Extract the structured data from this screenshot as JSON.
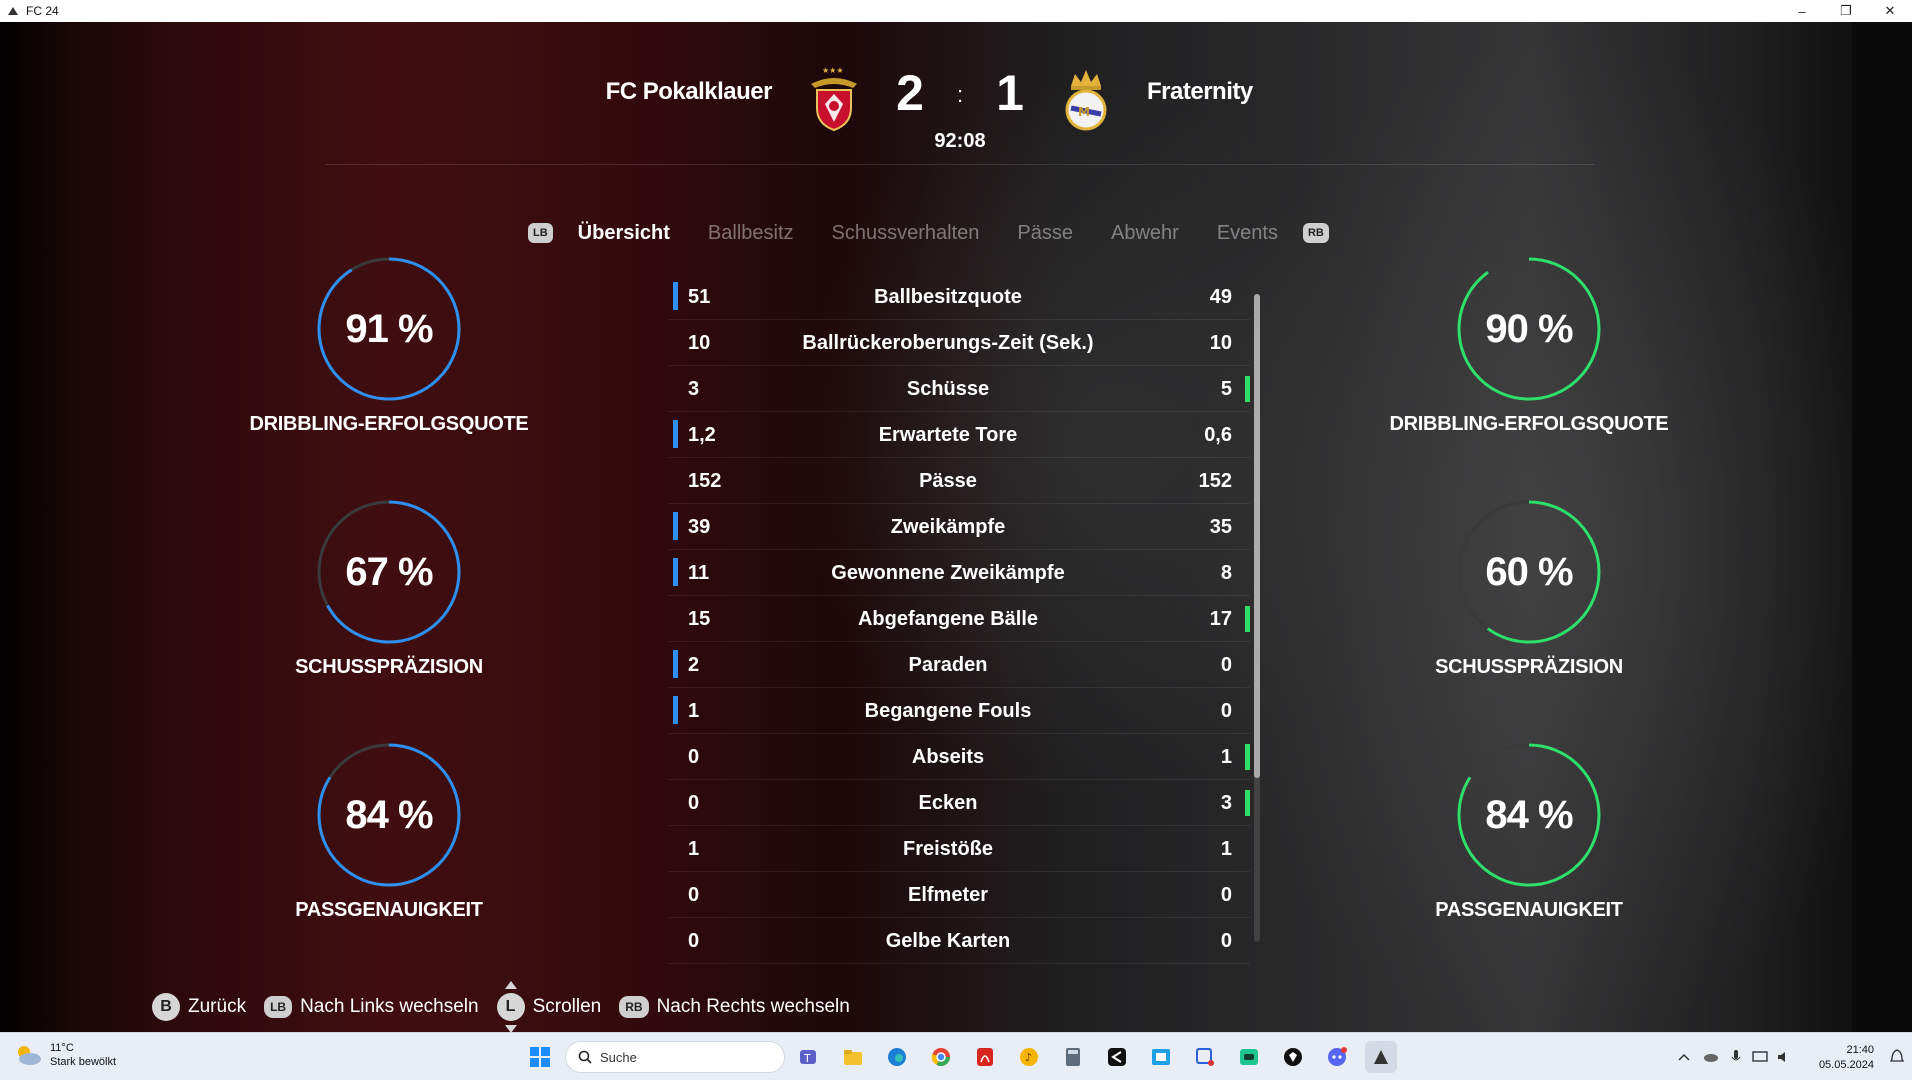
{
  "window": {
    "title": "FC 24",
    "controls": [
      "–",
      "❐",
      "✕"
    ]
  },
  "match": {
    "home_team": "FC Pokalklauer",
    "away_team": "Fraternity",
    "home_score": "2",
    "away_score": "1",
    "separator": ":",
    "time": "92:08"
  },
  "tabs": {
    "lb_badge": "LB",
    "rb_badge": "RB",
    "items": [
      "Übersicht",
      "Ballbesitz",
      "Schussverhalten",
      "Pässe",
      "Abwehr",
      "Events"
    ],
    "active_index": 0
  },
  "home_rings": [
    {
      "value": "91 %",
      "fraction": 0.91,
      "label": "DRIBBLING-ERFOLGSQUOTE"
    },
    {
      "value": "67 %",
      "fraction": 0.67,
      "label": "SCHUSSPRÄZISION"
    },
    {
      "value": "84 %",
      "fraction": 0.84,
      "label": "PASSGENAUIGKEIT"
    }
  ],
  "away_rings": [
    {
      "value": "90 %",
      "fraction": 0.9,
      "label": "DRIBBLING-ERFOLGSQUOTE"
    },
    {
      "value": "60 %",
      "fraction": 0.6,
      "label": "SCHUSSPRÄZISION"
    },
    {
      "value": "84 %",
      "fraction": 0.84,
      "label": "PASSGENAUIGKEIT"
    }
  ],
  "colors": {
    "home": "#2e8ff0",
    "away": "#2ee06b",
    "ring_track": "#3a3a3a"
  },
  "stats": [
    {
      "label": "Ballbesitzquote",
      "home": "51",
      "away": "49",
      "leader": "home"
    },
    {
      "label": "Ballrückeroberungs-Zeit (Sek.)",
      "home": "10",
      "away": "10",
      "leader": "none"
    },
    {
      "label": "Schüsse",
      "home": "3",
      "away": "5",
      "leader": "away"
    },
    {
      "label": "Erwartete Tore",
      "home": "1,2",
      "away": "0,6",
      "leader": "home"
    },
    {
      "label": "Pässe",
      "home": "152",
      "away": "152",
      "leader": "none"
    },
    {
      "label": "Zweikämpfe",
      "home": "39",
      "away": "35",
      "leader": "home"
    },
    {
      "label": "Gewonnene Zweikämpfe",
      "home": "11",
      "away": "8",
      "leader": "home"
    },
    {
      "label": "Abgefangene Bälle",
      "home": "15",
      "away": "17",
      "leader": "away"
    },
    {
      "label": "Paraden",
      "home": "2",
      "away": "0",
      "leader": "home"
    },
    {
      "label": "Begangene Fouls",
      "home": "1",
      "away": "0",
      "leader": "home"
    },
    {
      "label": "Abseits",
      "home": "0",
      "away": "1",
      "leader": "away"
    },
    {
      "label": "Ecken",
      "home": "0",
      "away": "3",
      "leader": "away"
    },
    {
      "label": "Freistöße",
      "home": "1",
      "away": "1",
      "leader": "none"
    },
    {
      "label": "Elfmeter",
      "home": "0",
      "away": "0",
      "leader": "none"
    },
    {
      "label": "Gelbe Karten",
      "home": "0",
      "away": "0",
      "leader": "none"
    }
  ],
  "hints": {
    "back_badge": "B",
    "back_label": "Zurück",
    "left_badge": "LB",
    "left_label": "Nach Links wechseln",
    "scroll_badge": "L",
    "scroll_label": "Scrollen",
    "right_badge": "RB",
    "right_label": "Nach Rechts wechseln"
  },
  "taskbar": {
    "weather_temp": "11°C",
    "weather_desc": "Stark bewölkt",
    "search_placeholder": "Suche",
    "time": "21:40",
    "date": "05.05.2024"
  }
}
